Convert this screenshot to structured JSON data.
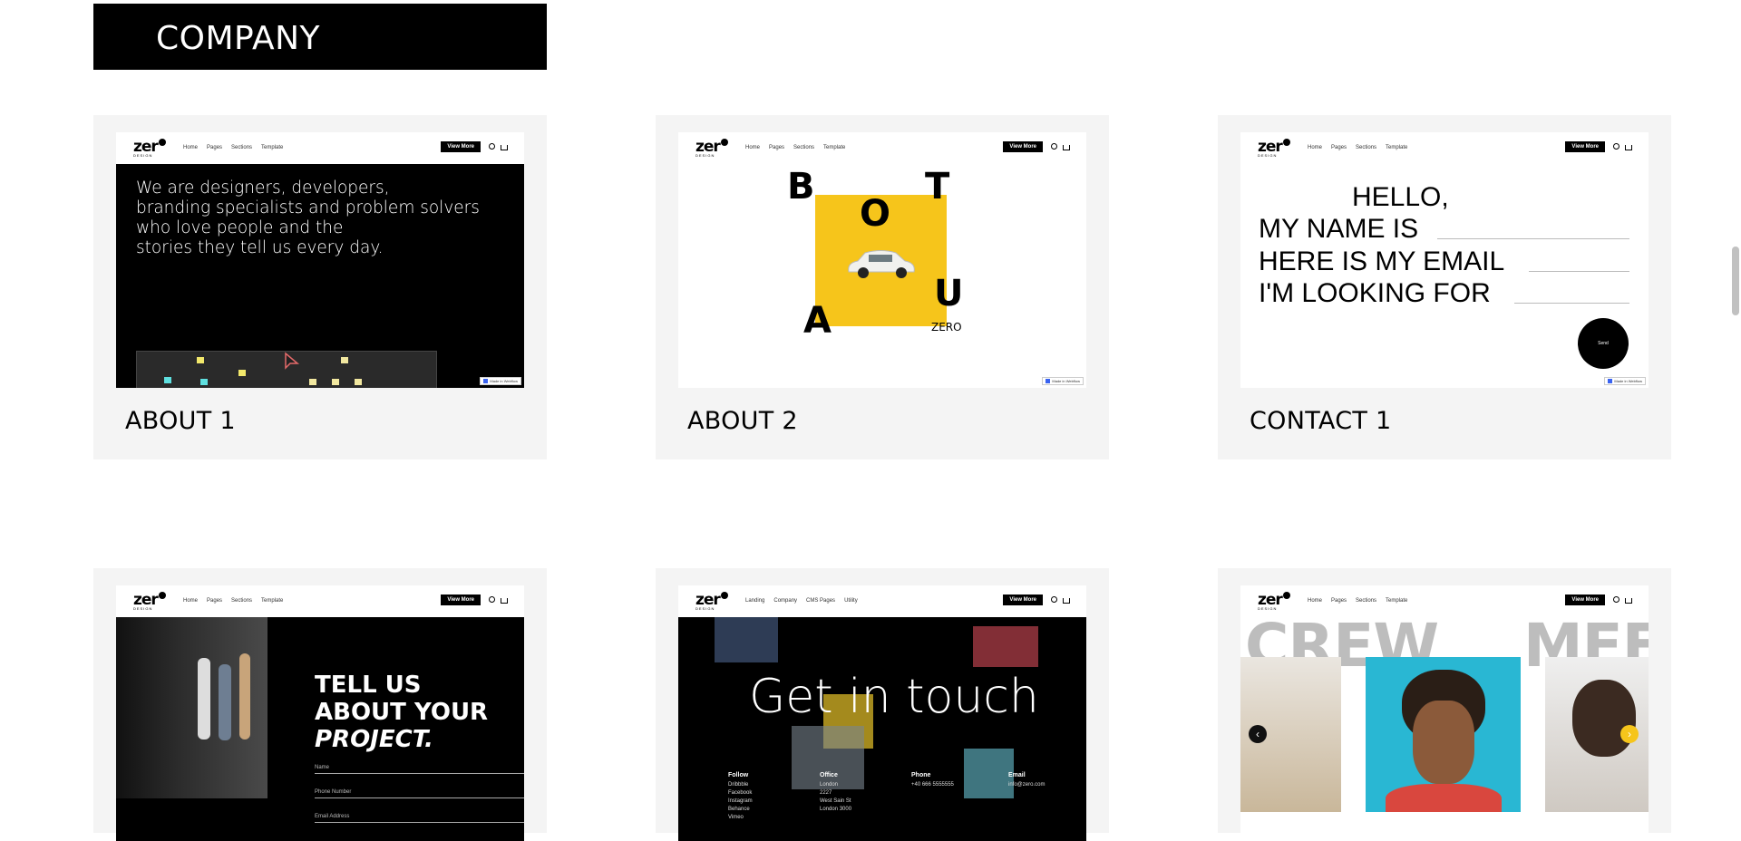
{
  "section": {
    "title": "COMPANY"
  },
  "nav": {
    "logo": "zer",
    "logo_sub": "DESIGN",
    "links": [
      "Home",
      "Pages",
      "Sections",
      "Template"
    ],
    "links_alt": [
      "Landing",
      "Company",
      "CMS Pages",
      "Utility"
    ],
    "view_more": "View More"
  },
  "badge": "Made in Webflow",
  "cards": [
    {
      "title": "ABOUT 1",
      "text_lines": [
        "We are designers, developers,",
        "branding specialists and problem solvers",
        "who love people and the",
        "stories they tell us every day."
      ]
    },
    {
      "title": "ABOUT 2",
      "letters": [
        "B",
        "O",
        "T",
        "A",
        "U"
      ],
      "caption": "ZERO"
    },
    {
      "title": "CONTACT 1",
      "lines": [
        "HELLO,",
        "MY NAME IS",
        "HERE IS MY EMAIL",
        "I'M LOOKING FOR"
      ],
      "send": "Send"
    },
    {
      "heading_lines": [
        "TELL US",
        "ABOUT YOUR",
        "PROJECT."
      ],
      "fields": [
        "Name",
        "Phone Number",
        "Email Address"
      ]
    },
    {
      "heading": "Get in touch",
      "columns": [
        {
          "head": "Follow",
          "items": [
            "Dribbble",
            "Facebook",
            "Instagram",
            "Behance",
            "Vimeo"
          ]
        },
        {
          "head": "Office",
          "items": [
            "London",
            "2227",
            "West Sain St",
            "London 3000"
          ]
        },
        {
          "head": "Phone",
          "items": [
            "+40 666 5555555"
          ]
        },
        {
          "head": "Email",
          "items": [
            "info@zero.com"
          ]
        }
      ]
    },
    {
      "crew_words": [
        "CREW",
        "MEE"
      ]
    }
  ],
  "colors": {
    "header_bg": "#000000",
    "card_bg": "#f4f4f4",
    "yellow": "#f6c51b",
    "cyan": "#29b7d3"
  }
}
